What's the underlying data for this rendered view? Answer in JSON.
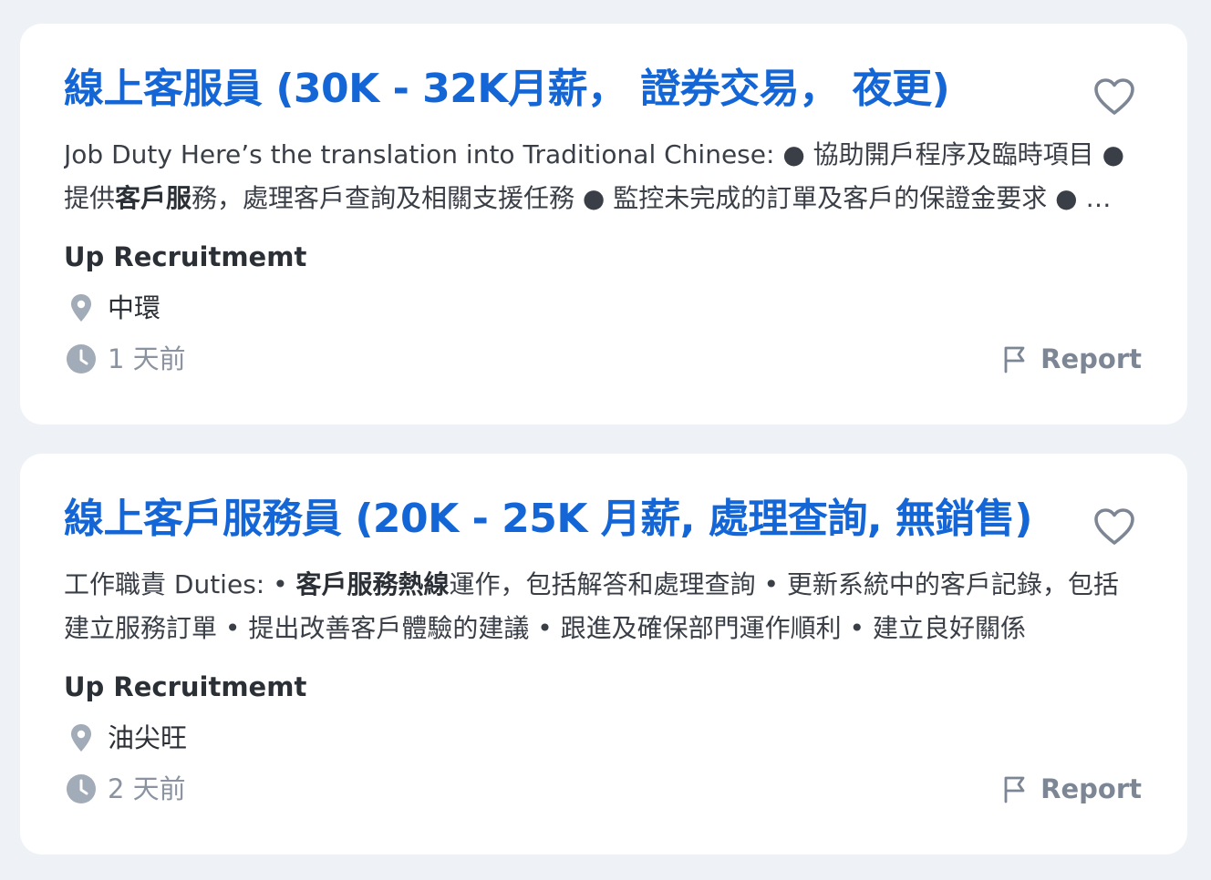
{
  "jobs": [
    {
      "title": "線上客服員 (30K - 32K月薪， 證券交易， 夜更)",
      "description": [
        {
          "text": "Job Duty Here’s the translation into Traditional Chinese: ● 協助開戶程序及臨時項目 ● 提供",
          "bold": false
        },
        {
          "text": "客戶服",
          "bold": true
        },
        {
          "text": "務，處理客戶查詢及相關支援任務 ● 監控未完成的訂單及客戶的保證金要求 ● 其他相關工作",
          "bold": false
        }
      ],
      "company": "Up Recruitmemt",
      "location": "中環",
      "posted": "1 天前",
      "report_label": "Report"
    },
    {
      "title": "線上客戶服務員 (20K - 25K 月薪, 處理查詢, 無銷售)",
      "description": [
        {
          "text": "工作職責 Duties: • ",
          "bold": false
        },
        {
          "text": "客戶服務熱線",
          "bold": true
        },
        {
          "text": "運作，包括解答和處理查詢 • 更新系統中的客戶記錄，包括建立服務訂單 • 提出改善客戶體驗的建議 • 跟進及確保部門運作順利 • 建立良好關係",
          "bold": false
        }
      ],
      "company": "Up Recruitmemt",
      "location": "油尖旺",
      "posted": "2 天前",
      "report_label": "Report"
    }
  ],
  "colors": {
    "title": "#1466d6",
    "background": "#eef2f7",
    "card": "#ffffff",
    "muted": "#8b93a0",
    "text": "#2b2f36"
  },
  "icons": {
    "favorite": "heart-outline-icon",
    "location": "map-pin-icon",
    "time": "clock-icon",
    "report": "flag-icon"
  }
}
